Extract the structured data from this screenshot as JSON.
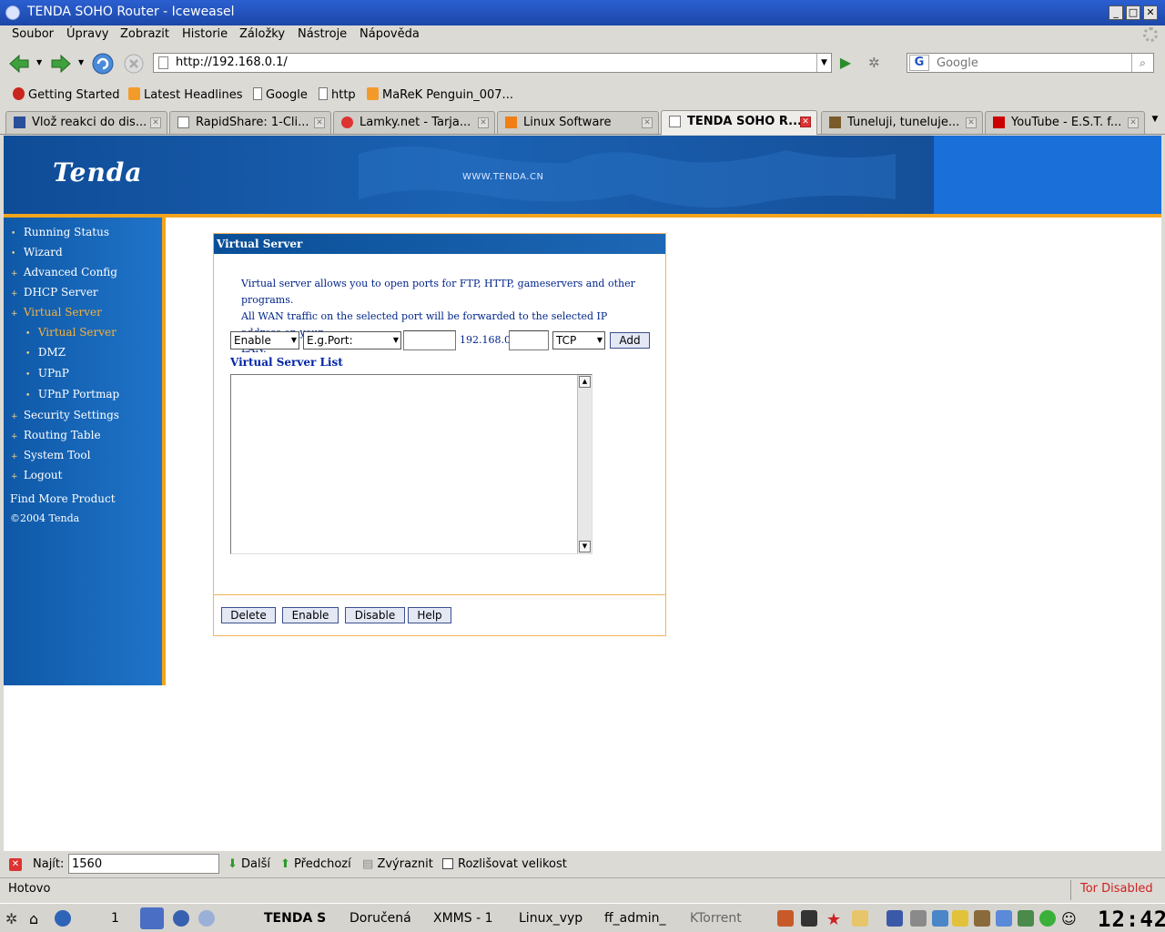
{
  "window": {
    "title": "TENDA SOHO Router - Iceweasel"
  },
  "menu": [
    "Soubor",
    "Úpravy",
    "Zobrazit",
    "Historie",
    "Záložky",
    "Nástroje",
    "Nápověda"
  ],
  "navbar": {
    "url": "http://192.168.0.1/",
    "search_placeholder": "Google",
    "search_engine": "G"
  },
  "bookmarks": [
    "Getting Started",
    "Latest Headlines",
    "Google",
    "http",
    "MaReK Penguin_007..."
  ],
  "tabs": [
    {
      "label": "Vlož reakci do dis...",
      "active": false
    },
    {
      "label": "RapidShare: 1-Cli...",
      "active": false
    },
    {
      "label": "Lamky.net - Tarja...",
      "active": false
    },
    {
      "label": "Linux Software",
      "active": false
    },
    {
      "label": "TENDA SOHO R...",
      "active": true
    },
    {
      "label": "Tuneluji, tuneluje...",
      "active": false
    },
    {
      "label": "YouTube - E.S.T. f...",
      "active": false
    }
  ],
  "page": {
    "logo": "Tenda",
    "banner_url": "WWW.TENDA.CN",
    "sidebar": [
      {
        "label": "Running Status",
        "sub": false,
        "selected": false
      },
      {
        "label": "Wizard",
        "sub": false,
        "selected": false
      },
      {
        "label": "Advanced Config",
        "sub": false,
        "selected": false
      },
      {
        "label": "DHCP Server",
        "sub": false,
        "selected": false
      },
      {
        "label": "Virtual Server",
        "sub": false,
        "selected": true
      },
      {
        "label": "Virtual Server",
        "sub": true,
        "selected": true
      },
      {
        "label": "DMZ",
        "sub": true,
        "selected": false
      },
      {
        "label": "UPnP",
        "sub": true,
        "selected": false
      },
      {
        "label": "UPnP Portmap",
        "sub": true,
        "selected": false
      },
      {
        "label": "Security Settings",
        "sub": false,
        "selected": false
      },
      {
        "label": "Routing Table",
        "sub": false,
        "selected": false
      },
      {
        "label": "System Tool",
        "sub": false,
        "selected": false
      },
      {
        "label": "Logout",
        "sub": false,
        "selected": false
      }
    ],
    "find_more": "Find More Product",
    "copyright": "©2004 Tenda",
    "panel": {
      "title": "Virtual Server",
      "desc": [
        "Virtual server allows you to open ports for FTP, HTTP, gameservers and other programs.",
        "All WAN traffic on the selected port will be forwarded to the selected IP address on your",
        "LAN."
      ],
      "enable_select": "Enable",
      "port_select": "E.g.Port:",
      "ip_prefix": "192.168.0.",
      "protocol_select": "TCP",
      "add_label": "Add",
      "list_title": "Virtual Server List",
      "buttons": [
        "Delete",
        "Enable",
        "Disable",
        "Help"
      ]
    }
  },
  "findbar": {
    "label": "Najít:",
    "value": "1560",
    "next": "Další",
    "prev": "Předchozí",
    "highlight": "Zvýraznit",
    "match_case": "Rozlišovat velikost"
  },
  "status": {
    "text": "Hotovo",
    "tor": "Tor Disabled"
  },
  "taskbar": {
    "desktop": "1",
    "windows": [
      "TENDA S",
      "Doručená",
      "XMMS - 1",
      "Linux_vyp",
      "ff_admin_",
      "KTorrent"
    ],
    "clock": "12:42"
  },
  "colors": {
    "banner_blue": "#1b62b3",
    "accent_orange": "#f3a51d",
    "panel_title": "#0a4f97",
    "text_blue": "#00258a"
  }
}
